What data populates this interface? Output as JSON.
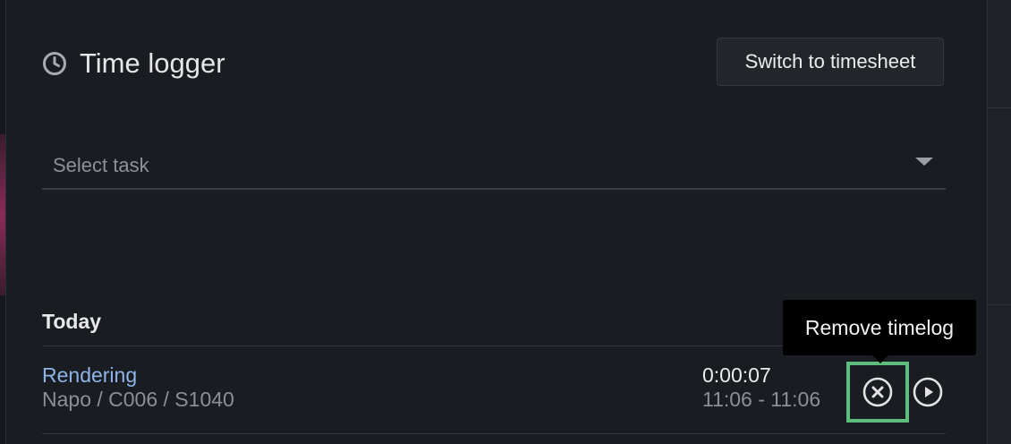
{
  "header": {
    "title": "Time logger",
    "icon": "clock-icon"
  },
  "toolbar": {
    "switch_label": "Switch to timesheet"
  },
  "task_select": {
    "placeholder": "Select task",
    "selected": ""
  },
  "timelog": {
    "section_title": "Today",
    "entries": [
      {
        "task": "Rendering",
        "path": "Napo / C006 / S1040",
        "duration": "0:00:07",
        "range": "11:06 - 11:06"
      }
    ]
  },
  "tooltip": {
    "text": "Remove timelog"
  },
  "colors": {
    "accent_link": "#8fb4e8",
    "highlight": "#5cbd7c",
    "panel_bg": "#191c21"
  }
}
